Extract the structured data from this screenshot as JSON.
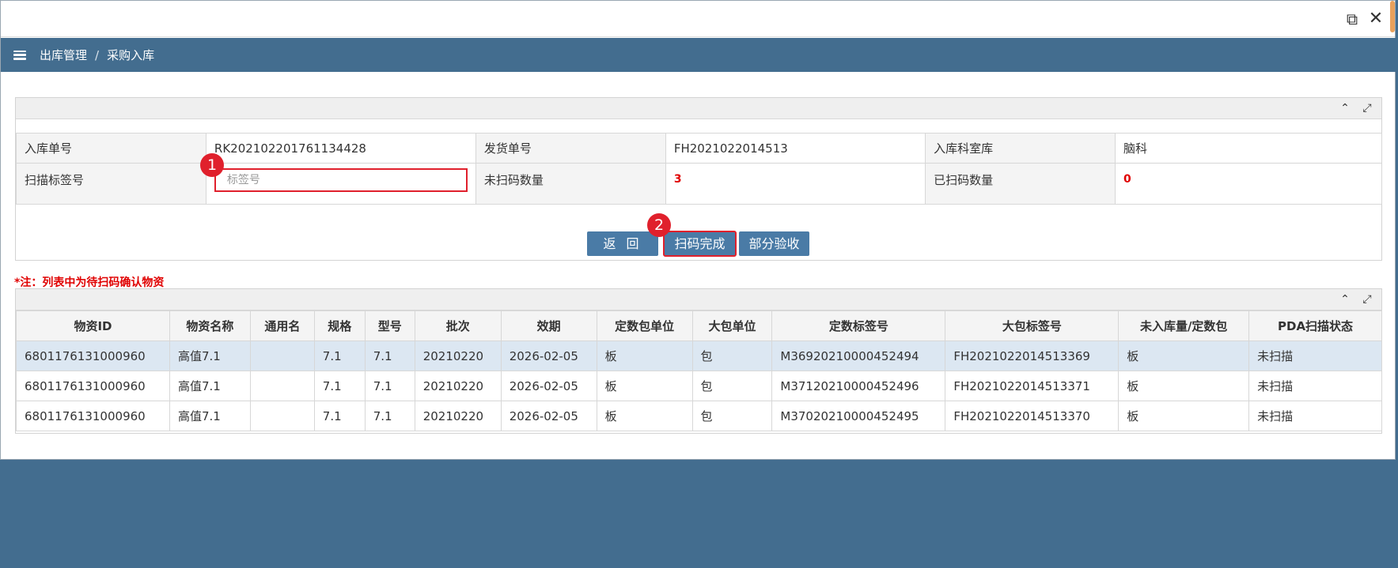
{
  "window": {
    "restore_icon": "restore-window-icon",
    "close_icon": "close-icon"
  },
  "breadcrumb": {
    "menu_icon": "hamburger-icon",
    "parent": "出库管理",
    "separator": "/",
    "current": "采购入库"
  },
  "form": {
    "row1": [
      {
        "label": "入库单号",
        "value": "RK202102201761134428"
      },
      {
        "label": "发货单号",
        "value": "FH2021022014513"
      },
      {
        "label": "入库科室库",
        "value": "脑科"
      }
    ],
    "tag_label": "扫描标签号",
    "tag_placeholder": "标签号",
    "unscanned_label": "未扫码数量",
    "unscanned_value": "3",
    "scanned_label": "已扫码数量",
    "scanned_value": "0"
  },
  "badges": {
    "one": "1",
    "two": "2"
  },
  "buttons": {
    "back": "返 回",
    "done": "扫码完成",
    "partial": "部分验收"
  },
  "note": "*注：列表中为待扫码确认物资",
  "table": {
    "columns": [
      "物资ID",
      "物资名称",
      "通用名",
      "规格",
      "型号",
      "批次",
      "效期",
      "定数包单位",
      "大包单位",
      "定数标签号",
      "大包标签号",
      "未入库量/定数包",
      "PDA扫描状态"
    ],
    "rows": [
      [
        "6801176131000960",
        "高值7.1",
        "",
        "7.1",
        "7.1",
        "20210220",
        "2026-02-05",
        "板",
        "包",
        "M36920210000452494",
        "FH2021022014513369",
        "板",
        "未扫描"
      ],
      [
        "6801176131000960",
        "高值7.1",
        "",
        "7.1",
        "7.1",
        "20210220",
        "2026-02-05",
        "板",
        "包",
        "M37120210000452496",
        "FH2021022014513371",
        "板",
        "未扫描"
      ],
      [
        "6801176131000960",
        "高值7.1",
        "",
        "7.1",
        "7.1",
        "20210220",
        "2026-02-05",
        "板",
        "包",
        "M37020210000452495",
        "FH2021022014513370",
        "板",
        "未扫描"
      ]
    ]
  },
  "colors": {
    "nav": "#436d8f",
    "button": "#4a7ba6",
    "highlight": "#e0202c"
  }
}
